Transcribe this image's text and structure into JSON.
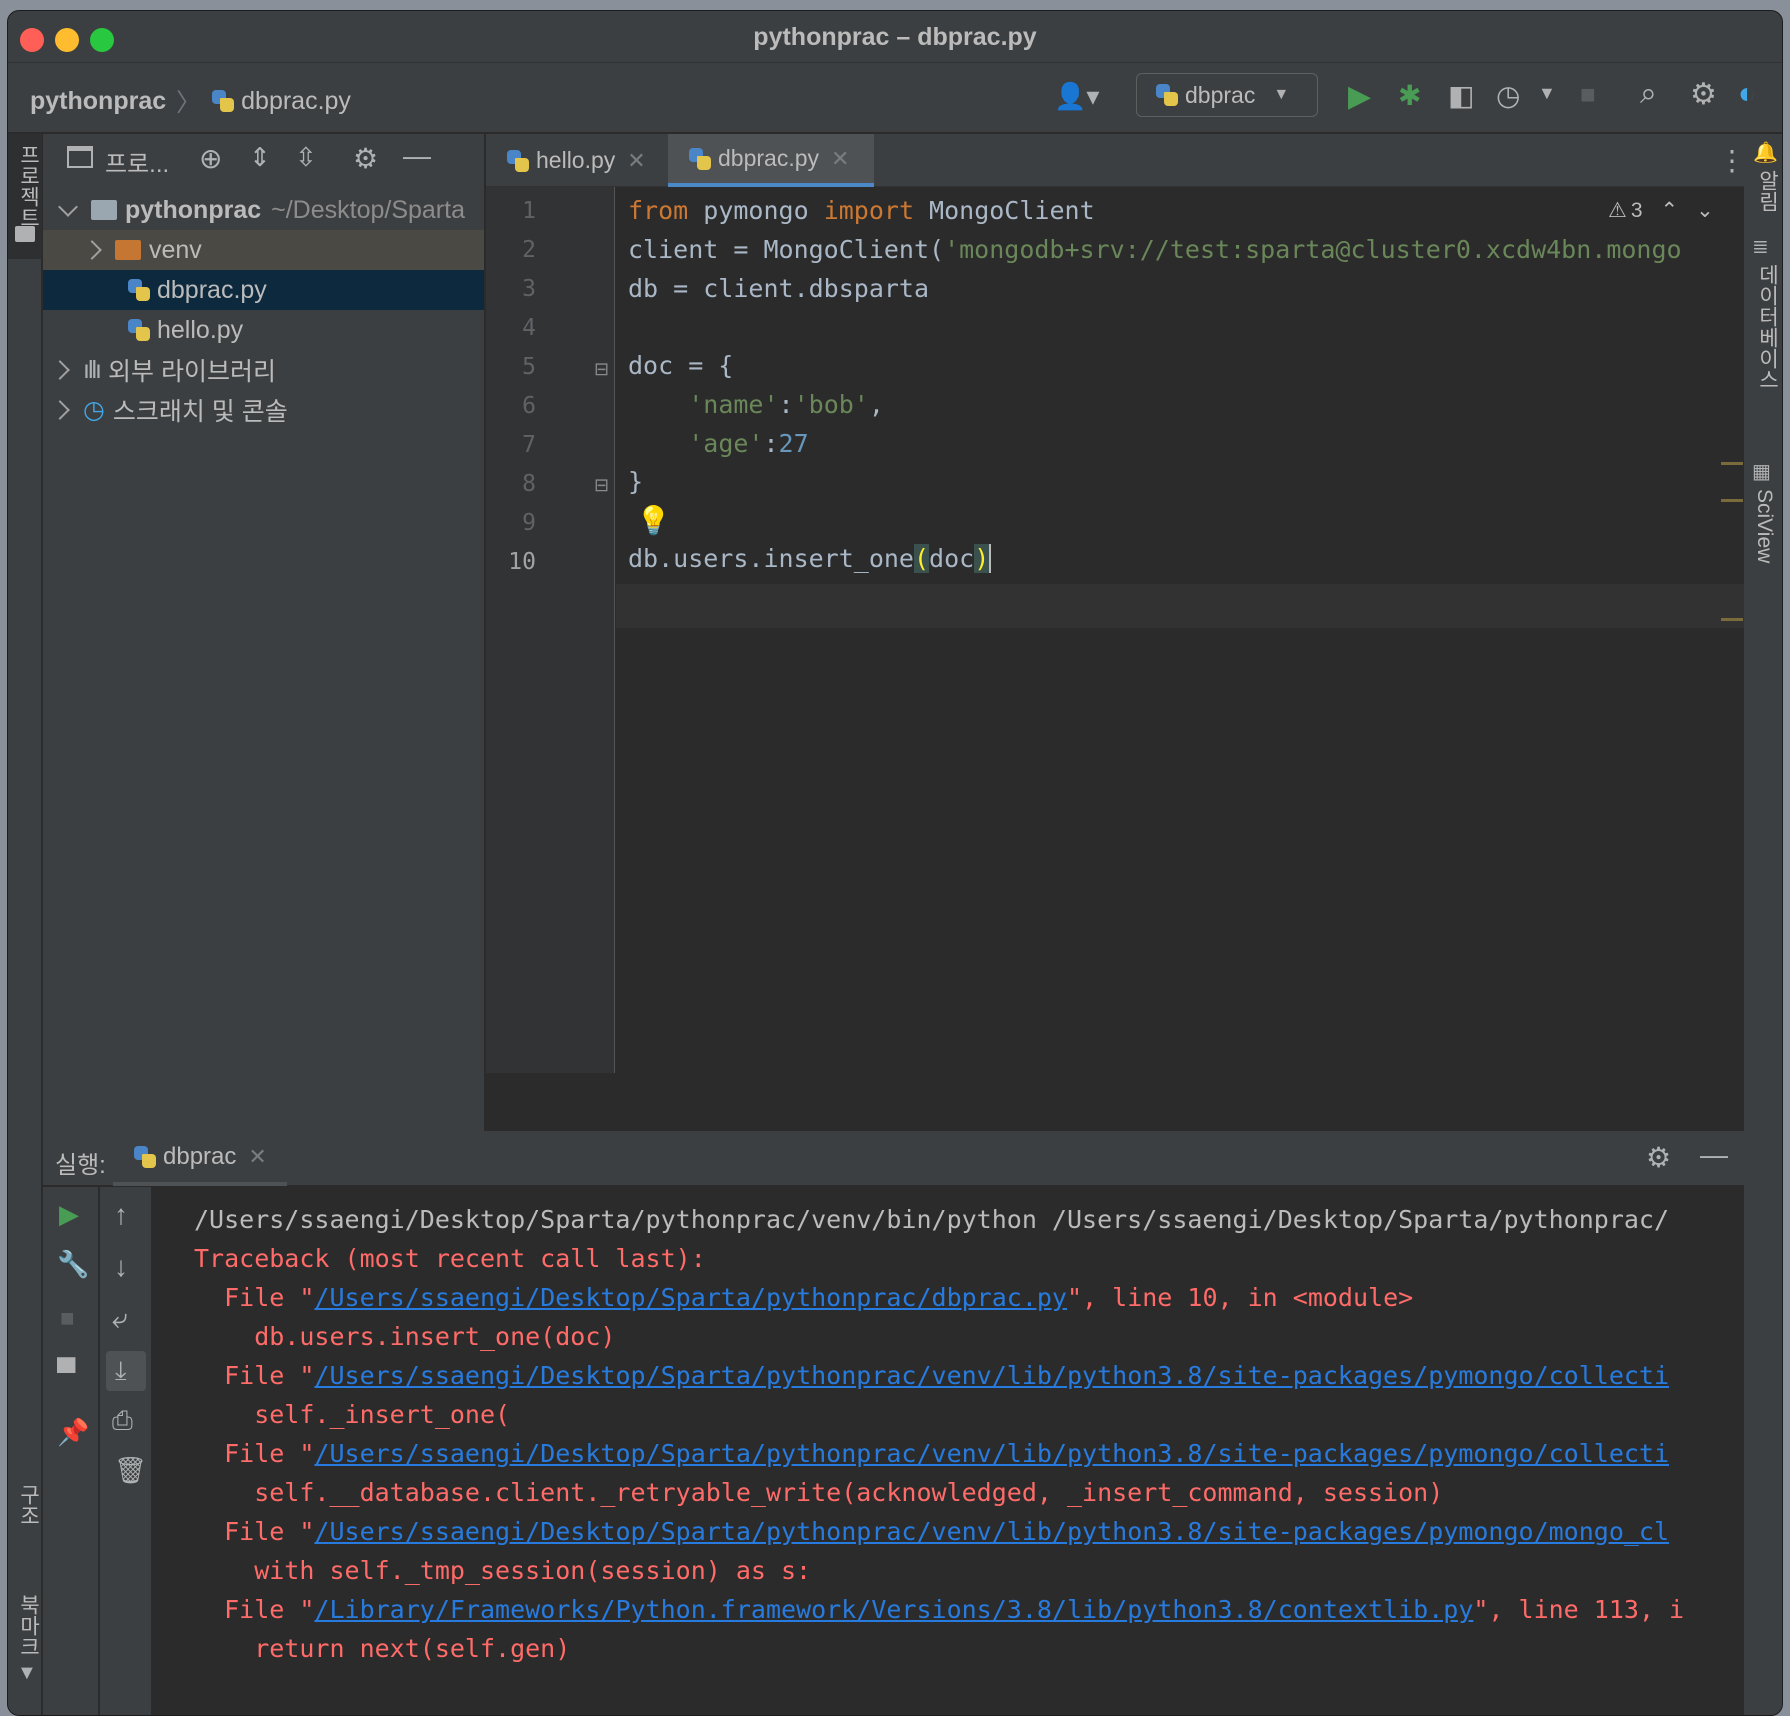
{
  "window": {
    "title": "pythonprac – dbprac.py"
  },
  "breadcrumb": {
    "project": "pythonprac",
    "file": "dbprac.py"
  },
  "run_config": {
    "label": "dbprac"
  },
  "left_strip": {
    "project_label": "프로젝트",
    "structure_label": "구조",
    "bookmarks_label": "북마크"
  },
  "right_strip": {
    "notifications_label": "알림",
    "database_label": "데이터베이스",
    "sciview_label": "SciView"
  },
  "project_panel": {
    "title": "프로...",
    "root": {
      "name": "pythonprac",
      "path": "~/Desktop/Sparta"
    },
    "items": [
      {
        "label": "venv"
      },
      {
        "label": "dbprac.py"
      },
      {
        "label": "hello.py"
      },
      {
        "label": "외부 라이브러리"
      },
      {
        "label": "스크래치 및 콘솔"
      }
    ]
  },
  "editor": {
    "tabs": [
      {
        "label": "hello.py"
      },
      {
        "label": "dbprac.py"
      }
    ],
    "warning_count": "3",
    "line_numbers": [
      "1",
      "2",
      "3",
      "4",
      "5",
      "6",
      "7",
      "8",
      "9",
      "10"
    ],
    "lines": {
      "l1_from": "from",
      "l1_mod": " pymongo ",
      "l1_import": "import",
      "l1_rest": " MongoClient",
      "l2_code": "client = MongoClient(",
      "l2_str": "'mongodb+srv://test:sparta@cluster0.xcdw4bn.mongo",
      "l3": "db = client.dbsparta",
      "l5": "doc = {",
      "l6_key": "'name'",
      "l6_colon": ":",
      "l6_val": "'bob'",
      "l6_comma": ",",
      "l7_key": "'age'",
      "l7_colon": ":",
      "l7_val": "27",
      "l8": "}",
      "l10_a": "db.users.insert_one",
      "l10_b": "(",
      "l10_c": "doc",
      "l10_d": ")"
    }
  },
  "run_panel": {
    "label": "실행:",
    "tab": "dbprac",
    "output": {
      "cmd": "/Users/ssaengi/Desktop/Sparta/pythonprac/venv/bin/python /Users/ssaengi/Desktop/Sparta/pythonprac/",
      "traceback": "Traceback (most recent call last):",
      "f1_pre": "  File \"",
      "f1_link": "/Users/ssaengi/Desktop/Sparta/pythonprac/dbprac.py",
      "f1_post": "\", line 10, in <module>",
      "c1": "    db.users.insert_one(doc)",
      "f2_pre": "  File \"",
      "f2_link": "/Users/ssaengi/Desktop/Sparta/pythonprac/venv/lib/python3.8/site-packages/pymongo/collecti",
      "c2": "    self._insert_one(",
      "f3_pre": "  File \"",
      "f3_link": "/Users/ssaengi/Desktop/Sparta/pythonprac/venv/lib/python3.8/site-packages/pymongo/collecti",
      "c3": "    self.__database.client._retryable_write(acknowledged, _insert_command, session)",
      "f4_pre": "  File \"",
      "f4_link": "/Users/ssaengi/Desktop/Sparta/pythonprac/venv/lib/python3.8/site-packages/pymongo/mongo_cl",
      "c4": "    with self._tmp_session(session) as s:",
      "f5_pre": "  File \"",
      "f5_link": "/Library/Frameworks/Python.framework/Versions/3.8/lib/python3.8/contextlib.py",
      "f5_post": "\", line 113, i",
      "c5": "    return next(self.gen)"
    }
  },
  "colors": {
    "accent": "#4a88c7",
    "error_text": "#ff6b68",
    "link": "#287bde",
    "keyword": "#cc7832",
    "string": "#6a8759",
    "number": "#6897bb",
    "run_green": "#499c54"
  }
}
